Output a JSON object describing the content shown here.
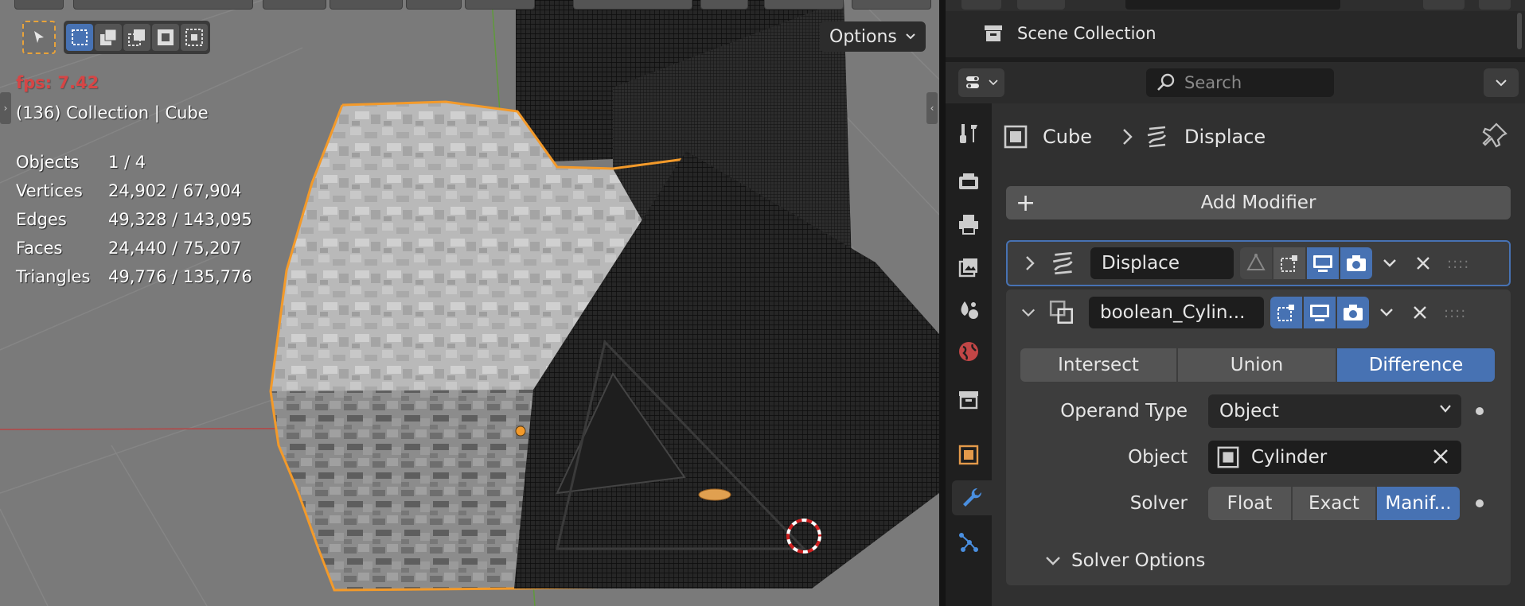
{
  "viewport": {
    "options_label": "Options",
    "fps": "fps: 7.42",
    "context": "(136) Collection | Cube",
    "stats": [
      {
        "key": "Objects",
        "value": "1 / 4"
      },
      {
        "key": "Vertices",
        "value": "24,902 / 67,904"
      },
      {
        "key": "Edges",
        "value": "49,328 / 143,095"
      },
      {
        "key": "Faces",
        "value": "24,440 / 75,207"
      },
      {
        "key": "Triangles",
        "value": "49,776 / 135,776"
      }
    ]
  },
  "outliner": {
    "scene_collection": "Scene Collection"
  },
  "properties": {
    "search_placeholder": "Search",
    "breadcrumb": {
      "object": "Cube",
      "modifier": "Displace"
    },
    "add_modifier": "Add Modifier",
    "modifiers": [
      {
        "name": "Displace",
        "expanded": false
      },
      {
        "name": "boolean_Cylin...",
        "expanded": true
      }
    ],
    "boolean": {
      "operations": [
        "Intersect",
        "Union",
        "Difference"
      ],
      "active_operation": "Difference",
      "operand_type_label": "Operand Type",
      "operand_type_value": "Object",
      "object_label": "Object",
      "object_value": "Cylinder",
      "solver_label": "Solver",
      "solvers": [
        "Float",
        "Exact",
        "Manif..."
      ],
      "active_solver": "Manif...",
      "solver_options": "Solver Options"
    }
  },
  "colors": {
    "accent_blue": "#4772b3",
    "selection_orange": "#e8a33a",
    "fps_red": "#d64545"
  }
}
